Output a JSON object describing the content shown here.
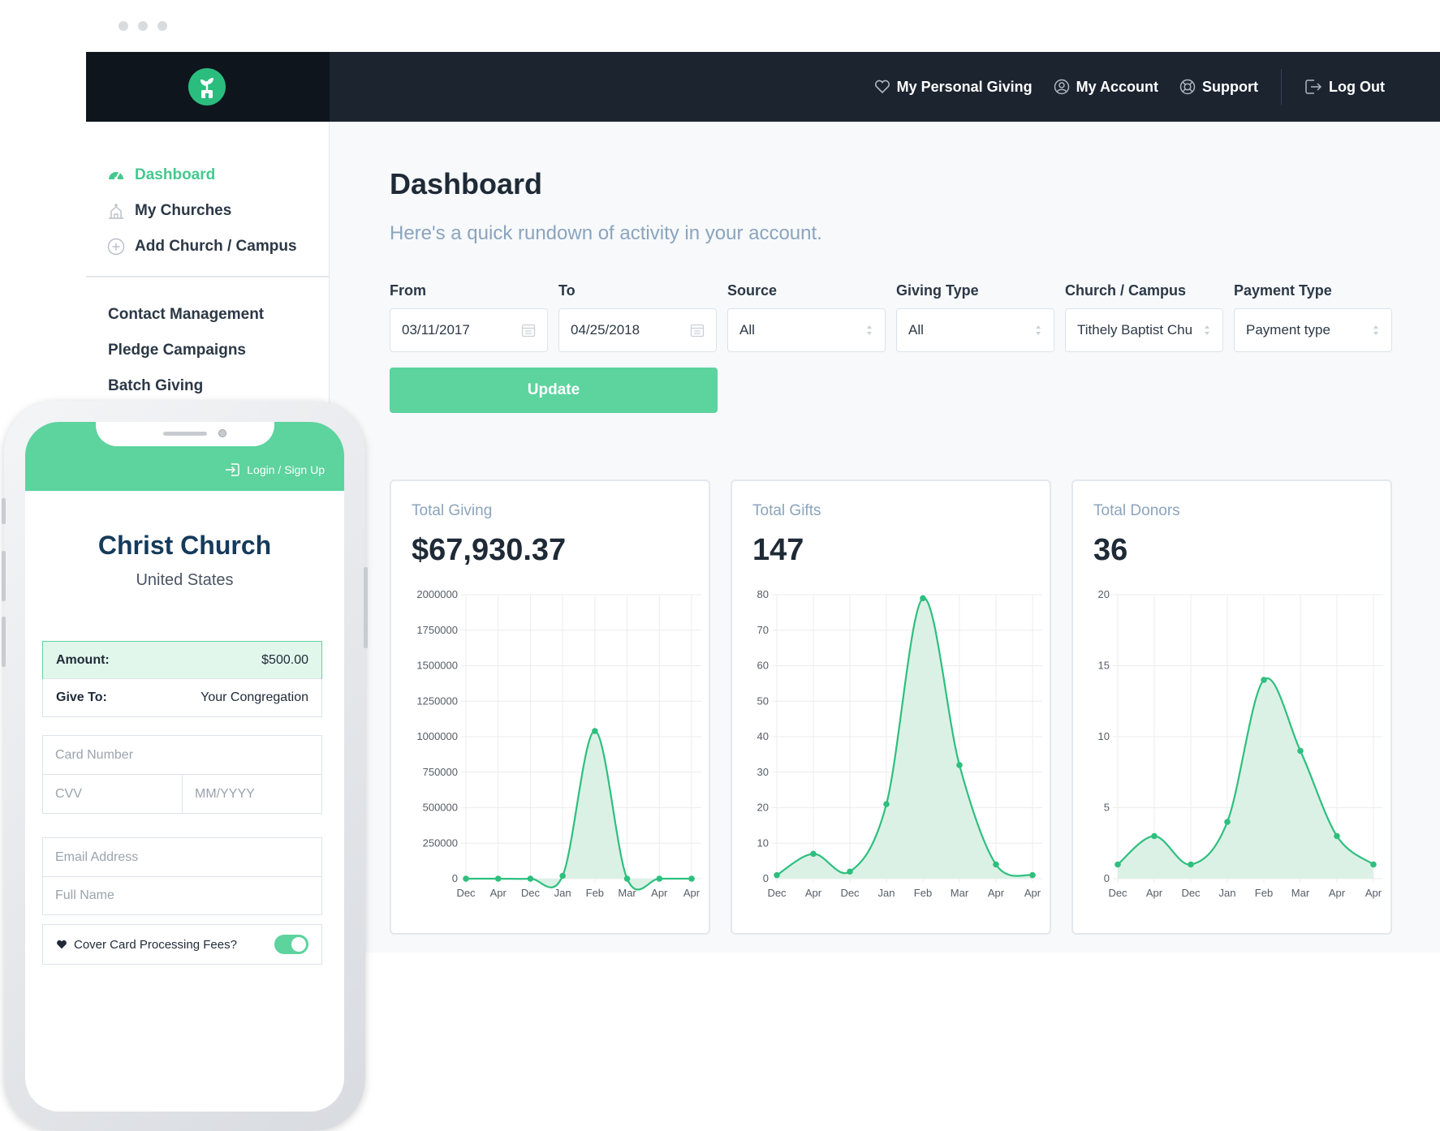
{
  "topnav": {
    "personal_giving": "My Personal Giving",
    "my_account": "My Account",
    "support": "Support",
    "logout": "Log Out"
  },
  "sidebar": {
    "primary": [
      {
        "label": "Dashboard",
        "icon": "speedometer-icon",
        "active": true
      },
      {
        "label": "My Churches",
        "icon": "church-icon",
        "active": false
      },
      {
        "label": "Add Church / Campus",
        "icon": "plus-circle-icon",
        "active": false
      }
    ],
    "secondary": [
      "Contact Management",
      "Pledge Campaigns",
      "Batch Giving"
    ]
  },
  "main": {
    "title": "Dashboard",
    "subtitle": "Here's a quick rundown of activity in your account.",
    "update_label": "Update",
    "filters": [
      {
        "label": "From",
        "value": "03/11/2017",
        "kind": "date"
      },
      {
        "label": "To",
        "value": "04/25/2018",
        "kind": "date"
      },
      {
        "label": "Source",
        "value": "All",
        "kind": "select"
      },
      {
        "label": "Giving Type",
        "value": "All",
        "kind": "select"
      },
      {
        "label": "Church / Campus",
        "value": "Tithely Baptist Chu",
        "kind": "select"
      },
      {
        "label": "Payment Type",
        "value": "Payment type",
        "kind": "select"
      }
    ]
  },
  "cards": [
    {
      "label": "Total Giving",
      "value": "$67,930.37"
    },
    {
      "label": "Total Gifts",
      "value": "147"
    },
    {
      "label": "Total Donors",
      "value": "36"
    }
  ],
  "chart_data": [
    {
      "type": "area",
      "x": [
        "Dec",
        "Apr",
        "Dec",
        "Jan",
        "Feb",
        "Mar",
        "Apr",
        "Apr"
      ],
      "series": [
        {
          "values": [
            0,
            0,
            0,
            20000,
            1040000,
            0,
            0,
            0
          ]
        }
      ],
      "yticks": [
        0,
        250000,
        500000,
        750000,
        1000000,
        1250000,
        1500000,
        1750000,
        2000000
      ],
      "ylim": [
        0,
        2000000
      ],
      "grid": true,
      "color": "#2ebf7e",
      "fill": "#dcf1e6"
    },
    {
      "type": "area",
      "x": [
        "Dec",
        "Apr",
        "Dec",
        "Jan",
        "Feb",
        "Mar",
        "Apr",
        "Apr"
      ],
      "series": [
        {
          "values": [
            1,
            7,
            2,
            21,
            79,
            32,
            4,
            1
          ]
        }
      ],
      "yticks": [
        0,
        10,
        20,
        30,
        40,
        50,
        60,
        70,
        80
      ],
      "ylim": [
        0,
        80
      ],
      "grid": true,
      "color": "#2ebf7e",
      "fill": "#dcf1e6"
    },
    {
      "type": "area",
      "x": [
        "Dec",
        "Apr",
        "Dec",
        "Jan",
        "Feb",
        "Mar",
        "Apr",
        "Apr"
      ],
      "series": [
        {
          "values": [
            1,
            3,
            1,
            4,
            14,
            9,
            3,
            1
          ]
        }
      ],
      "yticks": [
        0,
        5,
        10,
        15,
        20
      ],
      "ylim": [
        0,
        20
      ],
      "grid": true,
      "color": "#2ebf7e",
      "fill": "#dcf1e6"
    }
  ],
  "phone": {
    "login": "Login / Sign Up",
    "church_name": "Christ Church",
    "country": "United States",
    "amount_label": "Amount:",
    "amount_value": "$500.00",
    "give_to_label": "Give To:",
    "give_to_value": "Your Congregation",
    "card_number": "Card Number",
    "cvv": "CVV",
    "expiry": "MM/YYYY",
    "email": "Email Address",
    "full_name": "Full Name",
    "cover_fees": "Cover Card Processing Fees?",
    "cover_fees_on": true
  },
  "colors": {
    "accent": "#5dd39e",
    "dark": "#1c2430",
    "muted": "#8ba4bd"
  }
}
